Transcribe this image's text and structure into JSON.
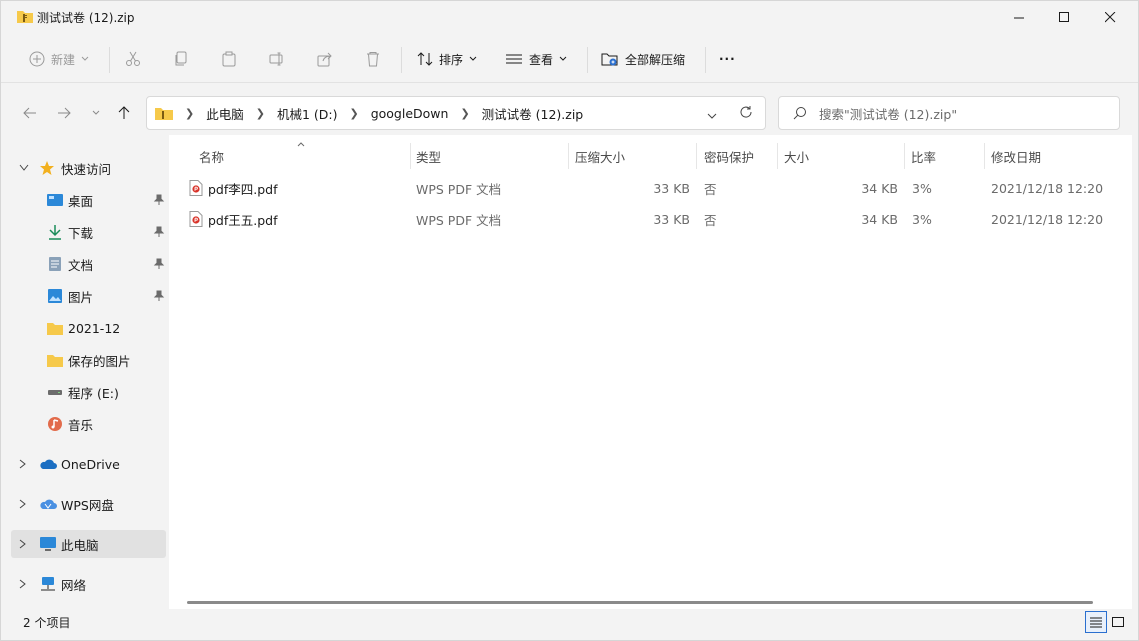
{
  "window": {
    "title": "测试试卷 (12).zip"
  },
  "toolbar": {
    "new_label": "新建",
    "sort_label": "排序",
    "view_label": "查看",
    "extract_all_label": "全部解压缩",
    "more_label": "···"
  },
  "address": {
    "crumbs": [
      "此电脑",
      "机械1 (D:)",
      "googleDown",
      "测试试卷 (12).zip"
    ]
  },
  "search": {
    "placeholder": "搜索\"测试试卷 (12).zip\""
  },
  "sidebar": {
    "quick_access": "快速访问",
    "items": [
      {
        "label": "桌面",
        "icon": "desktop-icon",
        "pinned": true
      },
      {
        "label": "下载",
        "icon": "download-icon",
        "pinned": true
      },
      {
        "label": "文档",
        "icon": "document-icon",
        "pinned": true
      },
      {
        "label": "图片",
        "icon": "pictures-icon",
        "pinned": true
      },
      {
        "label": "2021-12",
        "icon": "folder-icon",
        "pinned": false
      },
      {
        "label": "保存的图片",
        "icon": "folder-icon",
        "pinned": false
      },
      {
        "label": "程序 (E:)",
        "icon": "drive-icon",
        "pinned": false
      },
      {
        "label": "音乐",
        "icon": "music-icon",
        "pinned": false
      }
    ],
    "onedrive": "OneDrive",
    "wps": "WPS网盘",
    "this_pc": "此电脑",
    "network": "网络"
  },
  "table": {
    "columns": [
      "名称",
      "类型",
      "压缩大小",
      "密码保护",
      "大小",
      "比率",
      "修改日期"
    ],
    "rows": [
      {
        "name": "pdf李四.pdf",
        "type": "WPS PDF 文档",
        "compressed": "33 KB",
        "password": "否",
        "size": "34 KB",
        "ratio": "3%",
        "modified": "2021/12/18 12:20"
      },
      {
        "name": "pdf王五.pdf",
        "type": "WPS PDF 文档",
        "compressed": "33 KB",
        "password": "否",
        "size": "34 KB",
        "ratio": "3%",
        "modified": "2021/12/18 12:20"
      }
    ]
  },
  "status": {
    "item_count": "2 个项目"
  },
  "colors": {
    "accent": "#2a6fcf",
    "folder": "#f6c94a",
    "pdf": "#d9342b"
  }
}
